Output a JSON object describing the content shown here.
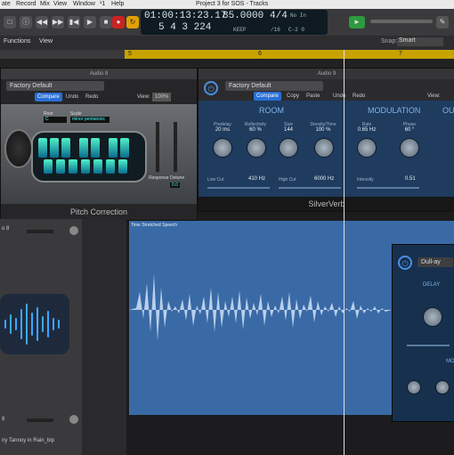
{
  "menu": {
    "items": [
      "ate",
      "Record",
      "Mix",
      "View",
      "Window",
      "¹1",
      "Help"
    ],
    "project_title": "Project 3 for SOS - Tracks"
  },
  "lcd": {
    "time": "01:00:13:23.17",
    "bars": "5  4  3  224",
    "tempo": "85.0000",
    "tempo_mode": "KEEP",
    "signature": "4/4",
    "division": "/16",
    "in_label": "No In",
    "out_label": "No Out",
    "key": "C-2  0"
  },
  "toolbar": {
    "functions": "Functions",
    "view": "View",
    "snap_label": "Snap:",
    "snap_value": "Smart"
  },
  "ruler": {
    "marks": [
      "5",
      "6",
      "7"
    ]
  },
  "pitch_plugin": {
    "track_label": "Audio 8",
    "preset": "Factory Default",
    "compare": "Compare",
    "undo": "Undo",
    "redo": "Redo",
    "view_label": "View:",
    "zoom": "100%",
    "root_label": "Root",
    "scale_label": "Scale",
    "root_value": "C",
    "scale_value": "minor pentatonic",
    "response_label": "Response",
    "detune_label": "Detune",
    "detune_value": "0.0",
    "name": "Pitch Correction"
  },
  "verb_plugin": {
    "track_label": "Audio 9",
    "preset": "Factory Default",
    "compare": "Compare",
    "copy": "Copy",
    "paste": "Paste",
    "undo": "Undo",
    "redo": "Redo",
    "view_label": "View:",
    "room_title": "ROOM",
    "modulation_title": "MODULATION",
    "out_title": "OU",
    "predelay_label": "Predelay",
    "predelay_value": "20 ms",
    "reflectivity_label": "Reflectivity",
    "reflectivity_value": "60 %",
    "size_label": "Size",
    "size_value": "144",
    "density_label": "Density/Time",
    "density_value": "100 %",
    "rate_label": "Rate",
    "rate_value": "0.65 Hz",
    "phase_label": "Phase",
    "phase_value": "60 °",
    "lowcut_label": "Low Cut",
    "lowcut_value": "410 Hz",
    "highcut_label": "High Cut",
    "highcut_value": "6000 Hz",
    "intensity_label": "Intensity",
    "intensity_value": "0.51",
    "name": "SilverVerb"
  },
  "region": {
    "name": "Time Stretched Speech"
  },
  "delay_plugin": {
    "preset": "Dull-ay",
    "section": "DELAY",
    "mod_section": "MO"
  },
  "tracks": {
    "top_label": "o 8",
    "bottom_number": "8",
    "bottom_name": "ny Tannoy in Rain_bip"
  },
  "colors": {
    "accent_blue": "#2a6fd6",
    "ruler_yellow": "#c8a300",
    "region_blue": "#3a6aa6",
    "verb_bg": "#1f3b5e"
  }
}
